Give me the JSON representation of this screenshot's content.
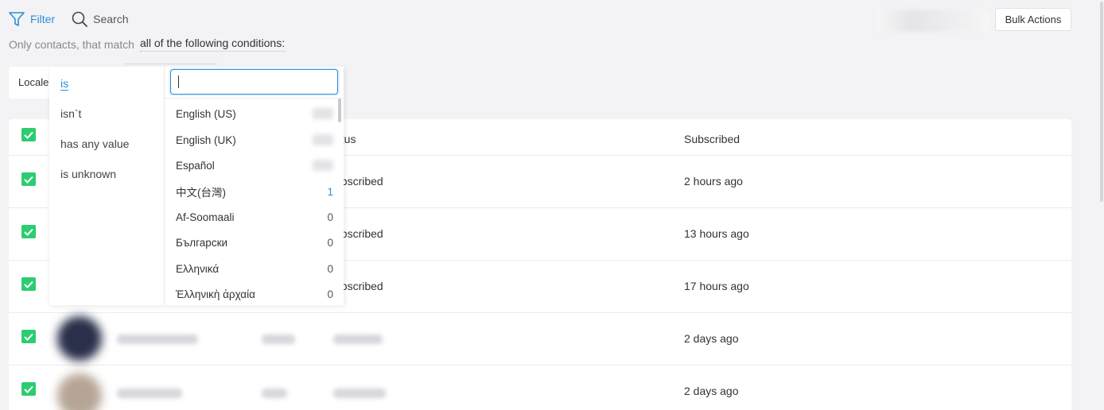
{
  "toolbar": {
    "filter_label": "Filter",
    "search_label": "Search",
    "bulk_actions_label": "Bulk Actions"
  },
  "condition": {
    "prefix": "Only contacts, that match",
    "match_mode": "all of the following conditions:"
  },
  "rule": {
    "field": "Locale"
  },
  "operators": [
    {
      "label": "is",
      "active": true
    },
    {
      "label": "isn`t",
      "active": false
    },
    {
      "label": "has any value",
      "active": false
    },
    {
      "label": "is unknown",
      "active": false
    }
  ],
  "search": {
    "value": ""
  },
  "options": [
    {
      "label": "English (US)",
      "count": ""
    },
    {
      "label": "English (UK)",
      "count": ""
    },
    {
      "label": "Español",
      "count": ""
    },
    {
      "label": "中文(台灣)",
      "count": "1"
    },
    {
      "label": "Af-Soomaali",
      "count": "0"
    },
    {
      "label": "Български",
      "count": "0"
    },
    {
      "label": "Ελληνικά",
      "count": "0"
    },
    {
      "label": "Ἑλληνικὴ ἀρχαία",
      "count": "0"
    }
  ],
  "table": {
    "headers": {
      "status": "atus",
      "subscribed": "Subscribed"
    },
    "rows": [
      {
        "status": "ubscribed",
        "subscribed": "2 hours ago"
      },
      {
        "status": "ubscribed",
        "subscribed": "13 hours ago"
      },
      {
        "status": "ubscribed",
        "subscribed": "17 hours ago"
      },
      {
        "status": "",
        "subscribed": "2 days ago"
      },
      {
        "status": "",
        "subscribed": "2 days ago"
      }
    ]
  },
  "colors": {
    "accent": "#2a8fd6",
    "checkbox": "#2ecc71"
  },
  "icons": {
    "filter": "filter-icon",
    "search": "search-icon",
    "check": "check-icon"
  }
}
